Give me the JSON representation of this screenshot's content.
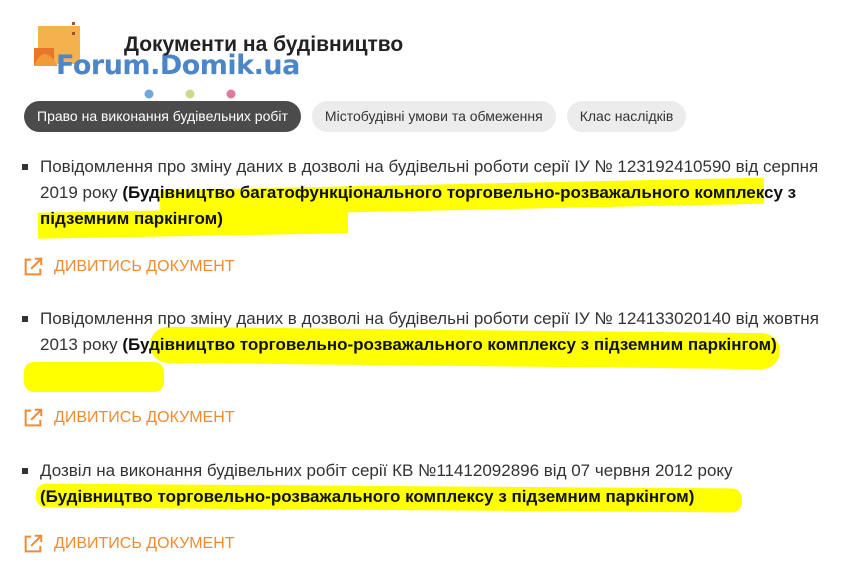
{
  "logo": {
    "text": "Forum.Domik.ua"
  },
  "page_title": "Документи на будівництво",
  "tabs": [
    {
      "label": "Право на виконання будівельних робіт",
      "active": true
    },
    {
      "label": "Містобудівні умови та обмеження",
      "active": false
    },
    {
      "label": "Клас наслідків",
      "active": false
    }
  ],
  "documents": [
    {
      "text": "Повідомлення про зміну даних в дозволі на будівельні роботи серії ІУ № 123192410590 від серпня 2019 року",
      "bold": "(Будівництво багатофункціонального торговельно-розважального комплексу з підземним паркінгом)",
      "link": "ДИВИТИСЬ ДОКУМЕНТ"
    },
    {
      "text": "Повідомлення про зміну даних в дозволі на будівельні роботи серії ІУ № 124133020140 від жовтня 2013 року",
      "bold": "(Будівництво торговельно-розважального комплексу з підземним паркінгом)",
      "link": "ДИВИТИСЬ ДОКУМЕНТ"
    },
    {
      "text": "Дозвіл на виконання будівельних робіт серії КВ №11412092896 від 07 червня 2012 року",
      "bold": "(Будівництво торговельно-розважального комплексу з підземним паркінгом)",
      "link": "ДИВИТИСЬ ДОКУМЕНТ"
    }
  ],
  "colors": {
    "accent": "#ef8c33",
    "highlight": "#ffff00",
    "active_tab": "#4b4b4b",
    "tab": "#ececec"
  }
}
